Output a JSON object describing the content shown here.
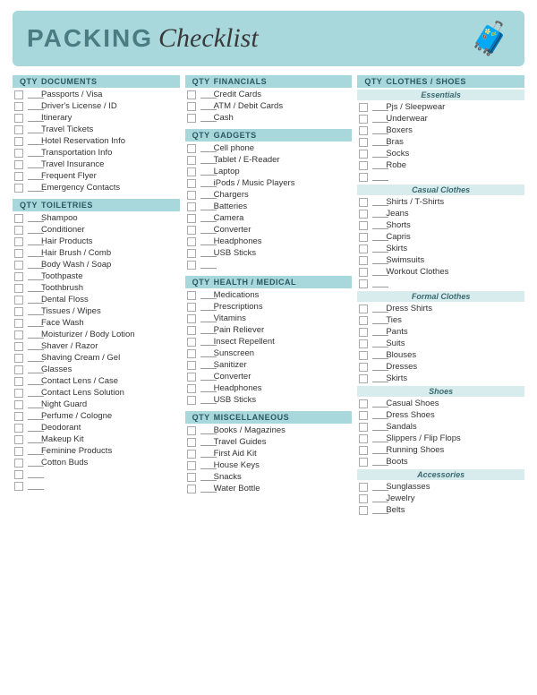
{
  "header": {
    "packing": "PACKING",
    "checklist": "Checklist",
    "icon": "🧳"
  },
  "columns": {
    "left": {
      "documents": {
        "section_label": "DOCUMENTS",
        "qty_label": "QTY",
        "items": [
          "Passports / Visa",
          "Driver's License / ID",
          "Itinerary",
          "Travel Tickets",
          "Hotel Reservation Info",
          "Transportation Info",
          "Travel Insurance",
          "Frequent Flyer",
          "Emergency Contacts"
        ]
      },
      "toiletries": {
        "section_label": "TOILETRIES",
        "qty_label": "QTY",
        "items": [
          "Shampoo",
          "Conditioner",
          "Hair Products",
          "Hair Brush / Comb",
          "Body Wash / Soap",
          "Toothpaste",
          "Toothbrush",
          "Dental Floss",
          "Tissues / Wipes",
          "Face Wash",
          "Moisturizer / Body Lotion",
          "Shaver / Razor",
          "Shaving Cream / Gel",
          "Glasses",
          "Contact Lens / Case",
          "Contact Lens Solution",
          "Night Guard",
          "Perfume / Cologne",
          "Deodorant",
          "Makeup Kit",
          "Feminine Products",
          "Cotton Buds",
          "",
          ""
        ]
      }
    },
    "mid": {
      "financials": {
        "section_label": "FINANCIALS",
        "qty_label": "QTY",
        "items": [
          "Credit Cards",
          "ATM / Debit Cards",
          "Cash"
        ]
      },
      "gadgets": {
        "section_label": "GADGETS",
        "qty_label": "QTY",
        "items": [
          "Cell phone",
          "Tablet / E-Reader",
          "Laptop",
          "iPods / Music Players",
          "Chargers",
          "Batteries",
          "Camera",
          "Converter",
          "Headphones",
          "USB Sticks",
          ""
        ]
      },
      "health": {
        "section_label": "HEALTH / MEDICAL",
        "qty_label": "QTY",
        "items": [
          "Medications",
          "Prescriptions",
          "Vitamins",
          "Pain Reliever",
          "Insect Repellent",
          "Sunscreen",
          "Sanitizer",
          "Converter",
          "Headphones",
          "USB Sticks"
        ]
      },
      "misc": {
        "section_label": "MISCELLANEOUS",
        "qty_label": "QTY",
        "items": [
          "Books / Magazines",
          "Travel Guides",
          "First Aid Kit",
          "House Keys",
          "Snacks",
          "Water Bottle"
        ]
      }
    },
    "right": {
      "clothes": {
        "section_label": "CLOTHES / SHOES",
        "qty_label": "QTY",
        "essentials_label": "Essentials",
        "essentials": [
          "Pjs / Sleepwear",
          "Underwear",
          "Boxers",
          "Bras",
          "Socks",
          "Robe",
          ""
        ],
        "casual_label": "Casual Clothes",
        "casual": [
          "Shirts / T-Shirts",
          "Jeans",
          "Shorts",
          "Capris",
          "Skirts",
          "Swimsuits",
          "Workout Clothes",
          ""
        ],
        "formal_label": "Formal Clothes",
        "formal": [
          "Dress Shirts",
          "Ties",
          "Pants",
          "Suits",
          "Blouses",
          "Dresses",
          "Skirts"
        ],
        "shoes_label": "Shoes",
        "shoes": [
          "Casual Shoes",
          "Dress Shoes",
          "Sandals",
          "Slippers / Flip Flops",
          "Running Shoes",
          "Boots"
        ],
        "accessories_label": "Accessories",
        "accessories": [
          "Sunglasses",
          "Jewelry",
          "Belts"
        ]
      }
    }
  }
}
